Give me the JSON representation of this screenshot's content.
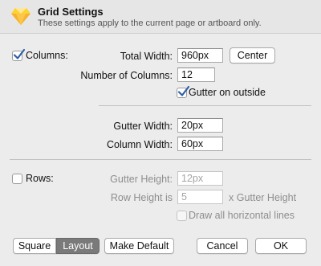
{
  "dialog": {
    "title": "Grid Settings",
    "subtitle": "These settings apply to the current page or artboard only."
  },
  "columns": {
    "enabled": true,
    "label": "Columns:",
    "total_width_label": "Total Width:",
    "total_width_value": "960px",
    "center_label": "Center",
    "number_of_columns_label": "Number of Columns:",
    "number_of_columns_value": "12",
    "gutter_on_outside_label": "Gutter on outside",
    "gutter_on_outside_checked": true,
    "gutter_width_label": "Gutter Width:",
    "gutter_width_value": "20px",
    "column_width_label": "Column Width:",
    "column_width_value": "60px"
  },
  "rows": {
    "enabled": false,
    "label": "Rows:",
    "gutter_height_label": "Gutter Height:",
    "gutter_height_value": "12px",
    "row_height_label": "Row Height is",
    "row_height_value": "5",
    "row_height_suffix": "x Gutter Height",
    "draw_all_lines_label": "Draw all horizontal lines",
    "draw_all_lines_checked": false
  },
  "footer": {
    "square_label": "Square",
    "layout_label": "Layout",
    "make_default_label": "Make Default",
    "cancel_label": "Cancel",
    "ok_label": "OK"
  },
  "colors": {
    "background": "#ececec",
    "checkmark": "#2f5fa8",
    "logo_gem": "#f7b22f"
  }
}
